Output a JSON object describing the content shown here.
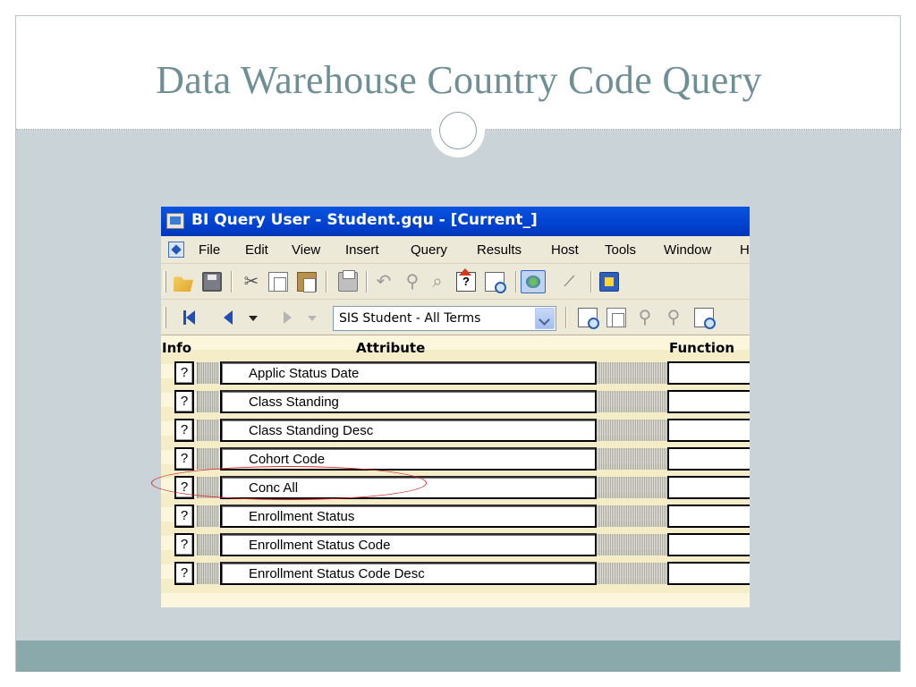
{
  "slide": {
    "title": "Data Warehouse Country Code Query",
    "colors": {
      "title": "#6e8f94",
      "panel": "#c9d3d8",
      "footer": "#8aa9ab",
      "highlight": "#d62a2a"
    }
  },
  "window": {
    "title": "BI Query User - Student.gqu - [Current_]",
    "title_bar_color": "#0a54e0"
  },
  "menu": [
    "File",
    "Edit",
    "View",
    "Insert",
    "Query",
    "Results",
    "Host",
    "Tools",
    "Window",
    "H"
  ],
  "toolbar": {
    "icons": [
      "open-folder-icon",
      "save-icon",
      "cut-icon",
      "copy-icon",
      "paste-icon",
      "print-icon",
      "undo-icon",
      "link-icon",
      "properties-icon",
      "help-icon",
      "zoom-icon",
      "run-query-icon",
      "pen-icon",
      "report-icon"
    ]
  },
  "navbar": {
    "model_select": {
      "value": "SIS Student - All Terms"
    }
  },
  "grid": {
    "headers": {
      "info": "Info",
      "attribute": "Attribute",
      "function": "Function"
    },
    "rows": [
      {
        "info": "?",
        "attribute": "Applic Status Date"
      },
      {
        "info": "?",
        "attribute": "Class Standing"
      },
      {
        "info": "?",
        "attribute": "Class Standing Desc"
      },
      {
        "info": "?",
        "attribute": "Cohort Code"
      },
      {
        "info": "?",
        "attribute": "Conc All"
      },
      {
        "info": "?",
        "attribute": "Enrollment Status"
      },
      {
        "info": "?",
        "attribute": "Enrollment Status Code"
      },
      {
        "info": "?",
        "attribute": "Enrollment Status Code Desc"
      }
    ]
  }
}
